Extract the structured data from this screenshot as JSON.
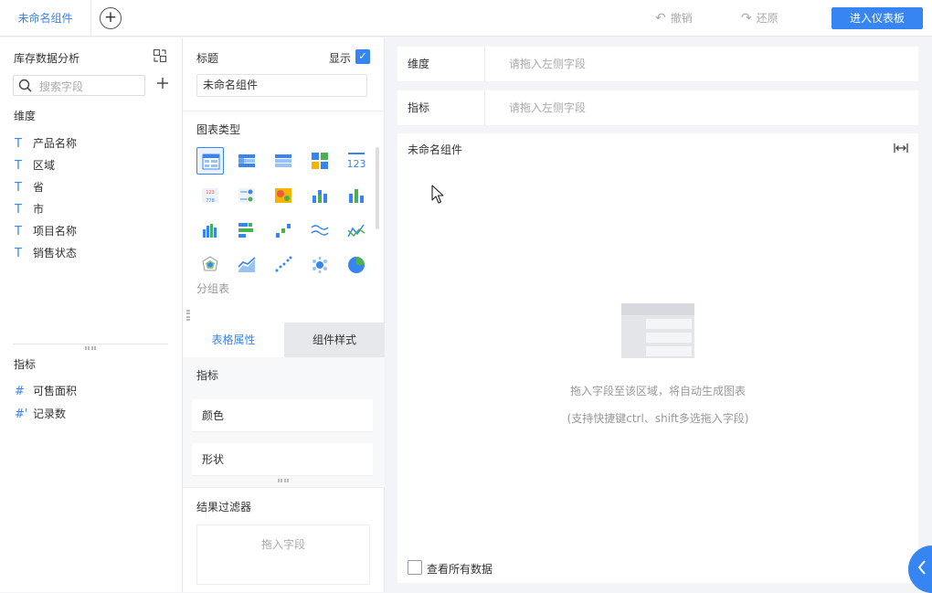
{
  "topbar": {
    "tab_label": "未命名组件",
    "add_tab_symbol": "+",
    "undo_label": "撤销",
    "redo_label": "还原",
    "enter_label": "进入仪表板"
  },
  "fields_panel": {
    "title": "库存数据分析",
    "search_placeholder": "搜索字段",
    "dimension_header": "维度",
    "dimension_type_symbol": "T",
    "dimensions": [
      "产品名称",
      "区域",
      "省",
      "市",
      "项目名称",
      "销售状态"
    ],
    "measure_header": "指标",
    "measures": [
      {
        "symbol": "#",
        "label": "可售面积"
      },
      {
        "symbol": "#'",
        "label": "记录数"
      }
    ]
  },
  "config_panel": {
    "title_label": "标题",
    "show_label": "显示",
    "show_checked": true,
    "title_value": "未命名组件",
    "chart_type_label": "图表类型",
    "chart_types": [
      "table-icon",
      "cross-table-icon",
      "detail-table-icon",
      "heatmap-grid-icon",
      "kpi-number-icon",
      "text-table-icon",
      "dot-table-icon",
      "map-heat-icon",
      "stacked-bar-icon",
      "grouped-bar-icon",
      "column-chart-icon",
      "horizontal-bar-icon",
      "waterfall-icon",
      "line-multi-icon",
      "line-chart-icon",
      "radar-icon",
      "area-chart-icon",
      "scatter-icon",
      "bubble-icon",
      "pie-chart-icon"
    ],
    "selected_chart_type": "table-icon",
    "chart_type_caption": "分组表",
    "tab_table_props": "表格属性",
    "tab_component_style": "组件样式",
    "metric_label": "指标",
    "props": [
      "颜色",
      "形状"
    ],
    "filter_label": "结果过滤器",
    "filter_drop_text": "拖入字段"
  },
  "canvas": {
    "dimension_zone_label": "维度",
    "dimension_zone_placeholder": "请拖入左侧字段",
    "metric_zone_label": "指标",
    "metric_zone_placeholder": "请拖入左侧字段",
    "chart_title": "未命名组件",
    "empty_hint": "拖入字段至该区域，将自动生成图表",
    "empty_subhint": "(支持快捷键ctrl、shift多选拖入字段)",
    "view_all_label": "查看所有数据",
    "view_all_checked": false
  },
  "colors": {
    "accent": "#3685f2",
    "border": "#e8e8e8",
    "canvas_bg": "#f2f4f7"
  }
}
